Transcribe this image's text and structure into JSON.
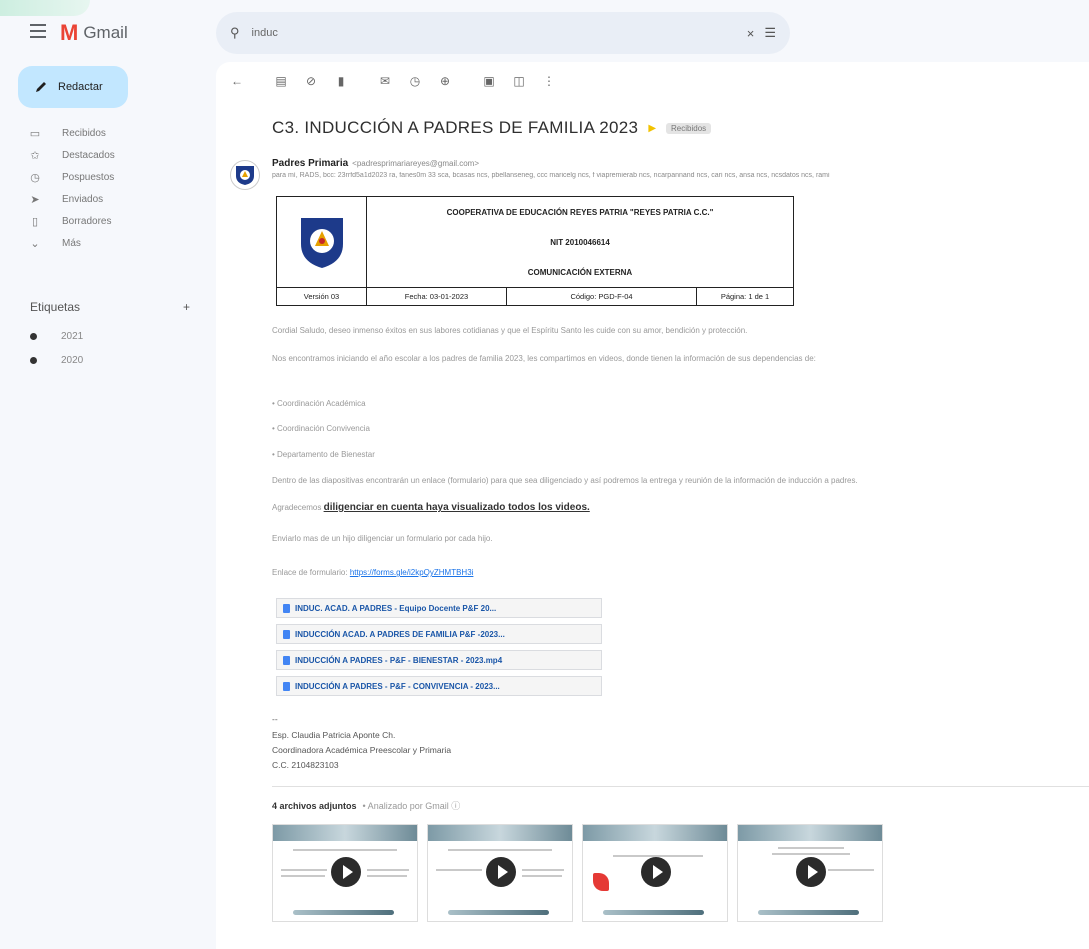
{
  "app": {
    "name": "Gmail"
  },
  "compose_label": "Redactar",
  "nav": [
    {
      "icon": "inbox-icon",
      "glyph": "▭",
      "label": "Recibidos"
    },
    {
      "icon": "star-icon",
      "glyph": "✩",
      "label": "Destacados"
    },
    {
      "icon": "clock-icon",
      "glyph": "◷",
      "label": "Pospuestos"
    },
    {
      "icon": "send-icon",
      "glyph": "➤",
      "label": "Enviados"
    },
    {
      "icon": "draft-icon",
      "glyph": "▯",
      "label": "Borradores"
    },
    {
      "icon": "chevron-down-icon",
      "glyph": "⌄",
      "label": "Más"
    }
  ],
  "labels_heading": "Etiquetas",
  "labels_add": "+",
  "labels": [
    "2021",
    "2020"
  ],
  "search": {
    "value": "induc",
    "clear": "×"
  },
  "subject": "C3. INDUCCIÓN A PADRES DE FAMILIA 2023",
  "inbox_chip": "Recibidos",
  "sender": {
    "name": "Padres Primaria",
    "email": "<padresprimariareyes@gmail.com>",
    "recipients": "para mí, RADS, bcc: 23rrfd5a1d2023 ra, fanes0m 33 sca, bcasas ncs, pbellanseneg, ccc maricelg ncs, f viapremierab ncs, ncarpannand ncs, cari ncs, ansa ncs, ncsdatos ncs, rami"
  },
  "doc_header": {
    "line1": "COOPERATIVA DE EDUCACIÓN REYES PATRIA \"REYES PATRIA C.C.\"",
    "line2": "NIT 2010046614",
    "line3": "COMUNICACIÓN EXTERNA",
    "version": "Versión 03",
    "date": "Fecha: 03-01-2023",
    "code": "Código: PGD-F-04",
    "page": "Página: 1 de 1"
  },
  "body": {
    "p1": "Cordial Saludo, deseo inmenso éxitos en sus labores cotidianas y que el Espíritu Santo les cuide con su amor, bendición y protección.",
    "p2": "Nos encontramos iniciando el año escolar a los padres de familia 2023, les compartimos en videos, donde tienen la información de sus dependencias de:",
    "bullets": [
      "Coordinación Académica",
      "Coordinación Convivencia",
      "Departamento de Bienestar"
    ],
    "p3": "Dentro de las diapositivas encontrarán un enlace (formulario) para que sea diligenciado y así podremos la entrega y reunión de la información de inducción a padres.",
    "p4_prefix": "Agradecemos ",
    "p4_link": "diligenciar en cuenta haya visualizado todos los videos.",
    "p5": "Enviarlo mas de un hijo diligenciar un formulario por cada hijo.",
    "p6_prefix": "Enlace de formulario: ",
    "p6_link": "https://forms.gle/i2kpQyZHMTBH3i"
  },
  "drive_files": [
    "INDUC. ACAD. A PADRES - Equipo Docente P&F 20...",
    "INDUCCIÓN ACAD. A PADRES DE FAMILIA P&F -2023...",
    "INDUCCIÓN A PADRES - P&F - BIENESTAR - 2023.mp4",
    "INDUCCIÓN A PADRES - P&F - CONVIVENCIA - 2023..."
  ],
  "signature": {
    "dash": "--",
    "name": "Esp. Claudia Patricia Aponte Ch.",
    "role": "Coordinadora Académica Preescolar y Primaria",
    "cc": "C.C. 2104823103"
  },
  "attachments": {
    "count_label": "4 archivos adjuntos",
    "scan_label": "• Analizado por Gmail ⓘ"
  }
}
